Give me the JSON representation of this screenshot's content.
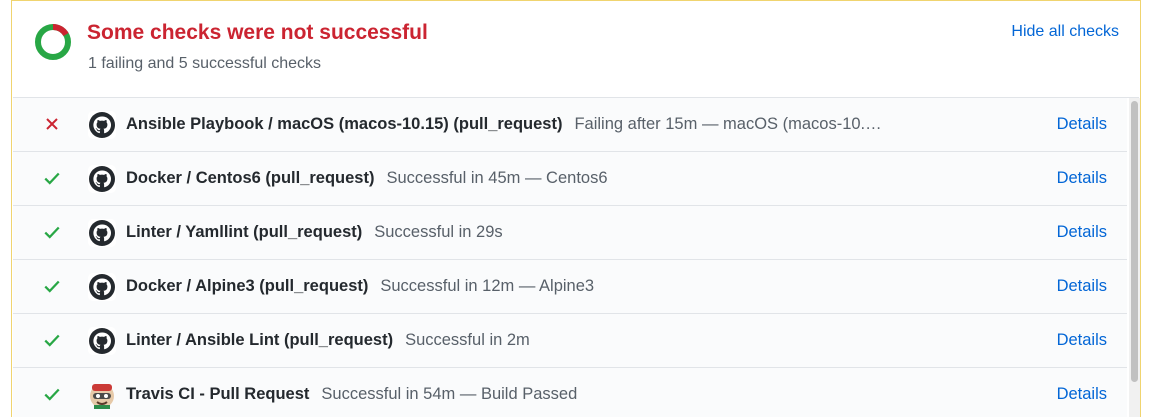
{
  "header": {
    "title": "Some checks were not successful",
    "subtitle": "1 failing and 5 successful checks",
    "hide_link": "Hide all checks"
  },
  "colors": {
    "fail": "#cb2431",
    "success": "#28a745",
    "link": "#0366d6",
    "frame_border": "#f0d46f"
  },
  "checks": [
    {
      "status": "failure",
      "status_icon": "x-icon",
      "app_icon": "github-icon",
      "name": "Ansible Playbook / macOS (macos-10.15) (pull_request)",
      "description": "Failing after 15m — macOS (macos-10.…",
      "details": "Details"
    },
    {
      "status": "success",
      "status_icon": "check-icon",
      "app_icon": "github-icon",
      "name": "Docker / Centos6 (pull_request)",
      "description": "Successful in 45m — Centos6",
      "details": "Details"
    },
    {
      "status": "success",
      "status_icon": "check-icon",
      "app_icon": "github-icon",
      "name": "Linter / Yamllint (pull_request)",
      "description": "Successful in 29s",
      "details": "Details"
    },
    {
      "status": "success",
      "status_icon": "check-icon",
      "app_icon": "github-icon",
      "name": "Docker / Alpine3 (pull_request)",
      "description": "Successful in 12m — Alpine3",
      "details": "Details"
    },
    {
      "status": "success",
      "status_icon": "check-icon",
      "app_icon": "github-icon",
      "name": "Linter / Ansible Lint (pull_request)",
      "description": "Successful in 2m",
      "details": "Details"
    },
    {
      "status": "success",
      "status_icon": "check-icon",
      "app_icon": "travis-ci-icon",
      "name": "Travis CI - Pull Request",
      "description": "Successful in 54m — Build Passed",
      "details": "Details"
    }
  ]
}
